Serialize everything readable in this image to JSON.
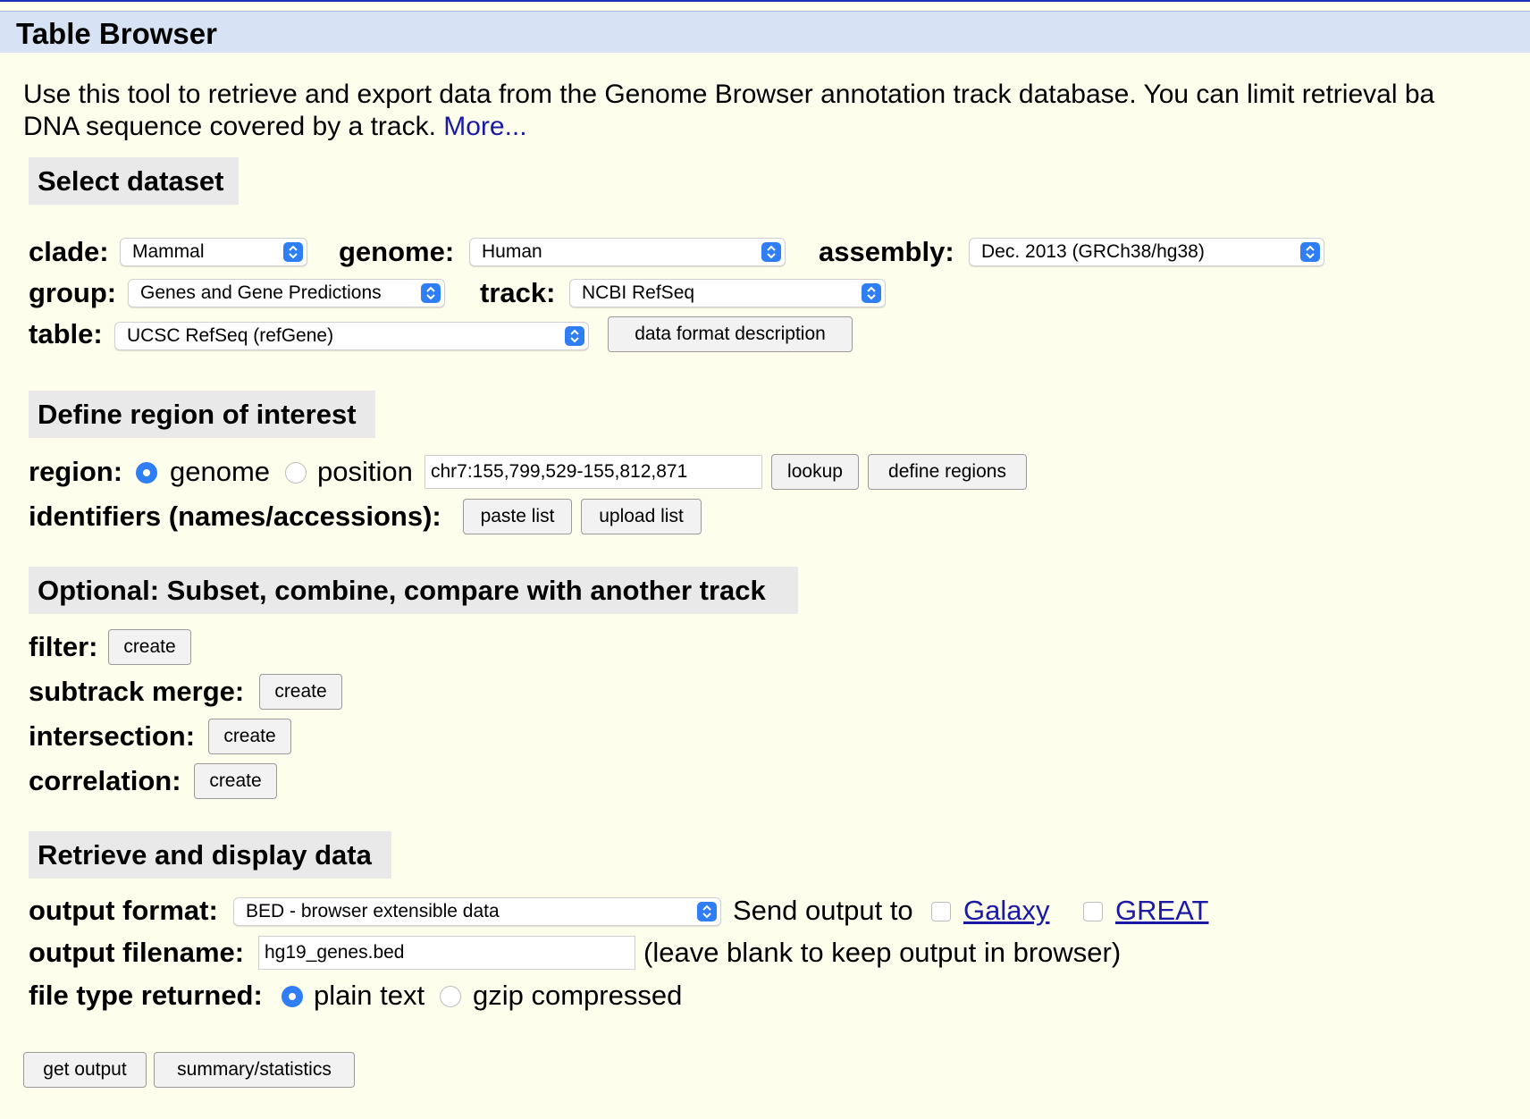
{
  "page": {
    "title": "Table Browser",
    "intro_line1": "Use this tool to retrieve and export data from the Genome Browser annotation track database. You can limit retrieval ba",
    "intro_line2": "DNA sequence covered by a track. ",
    "more_link": "More..."
  },
  "select_dataset": {
    "heading": "Select dataset",
    "clade_label": "clade:",
    "clade_value": "Mammal",
    "genome_label": "genome:",
    "genome_value": "Human",
    "assembly_label": "assembly:",
    "assembly_value": "Dec. 2013 (GRCh38/hg38)",
    "group_label": "group:",
    "group_value": "Genes and Gene Predictions",
    "track_label": "track:",
    "track_value": "NCBI RefSeq",
    "table_label": "table:",
    "table_value": "UCSC RefSeq (refGene)",
    "data_format_button": "data format description"
  },
  "region": {
    "heading": "Define region of interest",
    "region_label": "region:",
    "genome_option": "genome",
    "position_option": "position",
    "selected": "genome",
    "position_value": "chr7:155,799,529-155,812,871",
    "lookup_button": "lookup",
    "define_regions_button": "define regions",
    "identifiers_label": "identifiers (names/accessions):",
    "paste_list_button": "paste list",
    "upload_list_button": "upload list"
  },
  "optional": {
    "heading": "Optional: Subset, combine, compare with another track",
    "filter_label": "filter:",
    "subtrack_merge_label": "subtrack merge:",
    "intersection_label": "intersection:",
    "correlation_label": "correlation:",
    "create_button": "create"
  },
  "retrieve": {
    "heading": "Retrieve and display data",
    "output_format_label": "output format:",
    "output_format_value": "BED - browser extensible data",
    "send_output_text": "Send output to",
    "galaxy_link": "Galaxy",
    "great_link": "GREAT",
    "output_filename_label": "output filename:",
    "output_filename_value": "hg19_genes.bed",
    "filename_hint": "(leave blank to keep output in browser)",
    "file_type_label": "file type returned:",
    "plain_text_option": "plain text",
    "gzip_option": "gzip compressed",
    "selected_file_type": "plain text",
    "get_output_button": "get output",
    "summary_button": "summary/statistics"
  },
  "colors": {
    "page_background": "#fefeec",
    "title_bar": "#d8e2f5",
    "section_heading": "#e9e9e9",
    "link": "#1a1aa6",
    "control_accent": "#2f7ef6"
  }
}
